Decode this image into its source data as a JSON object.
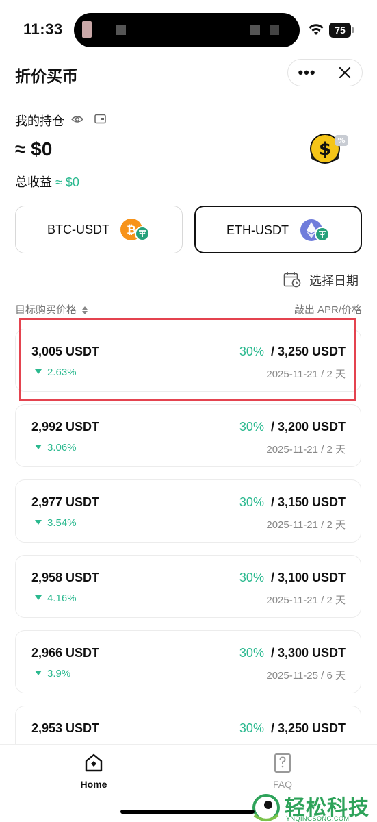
{
  "status_bar": {
    "time": "11:33",
    "battery": "75"
  },
  "header": {
    "title": "折价买币",
    "more_label": "•••"
  },
  "holdings": {
    "label": "我的持仓",
    "value": "≈ $0",
    "pnl_label": "总收益",
    "pnl_value": "≈ $0"
  },
  "pairs": [
    {
      "label": "BTC-USDT",
      "active": false
    },
    {
      "label": "ETH-USDT",
      "active": true
    }
  ],
  "date_selector": {
    "label": "选择日期"
  },
  "columns": {
    "target_price": "目标购买价格",
    "sell_apr": "敲出 APR/价格"
  },
  "offers": [
    {
      "price": "3,005 USDT",
      "change": "2.63%",
      "apr": "30%",
      "sell": "/ 3,250 USDT",
      "date": "2025-11-21 / 2 天"
    },
    {
      "price": "2,992 USDT",
      "change": "3.06%",
      "apr": "30%",
      "sell": "/ 3,200 USDT",
      "date": "2025-11-21 / 2 天"
    },
    {
      "price": "2,977 USDT",
      "change": "3.54%",
      "apr": "30%",
      "sell": "/ 3,150 USDT",
      "date": "2025-11-21 / 2 天"
    },
    {
      "price": "2,958 USDT",
      "change": "4.16%",
      "apr": "30%",
      "sell": "/ 3,100 USDT",
      "date": "2025-11-21 / 2 天"
    },
    {
      "price": "2,966 USDT",
      "change": "3.9%",
      "apr": "30%",
      "sell": "/ 3,300 USDT",
      "date": "2025-11-25 / 6 天"
    },
    {
      "price": "2,953 USDT",
      "change": "",
      "apr": "30%",
      "sell": "/ 3,250 USDT",
      "date": ""
    }
  ],
  "nav": {
    "home": "Home",
    "faq": "FAQ"
  },
  "watermark": {
    "cn": "轻松科技",
    "en": "YNQINGSONG.COM"
  },
  "colors": {
    "accent_green": "#2bb98f",
    "highlight_red": "#e4434f",
    "text_primary": "#111111",
    "text_muted": "#888888"
  },
  "icons": [
    "wifi-icon",
    "battery-icon",
    "more-icon",
    "close-icon",
    "eye-icon",
    "wallet-icon",
    "dollar-coin-icon",
    "bitcoin-icon",
    "ethereum-icon",
    "tether-icon",
    "calendar-icon",
    "sort-icon",
    "home-icon",
    "faq-icon"
  ]
}
